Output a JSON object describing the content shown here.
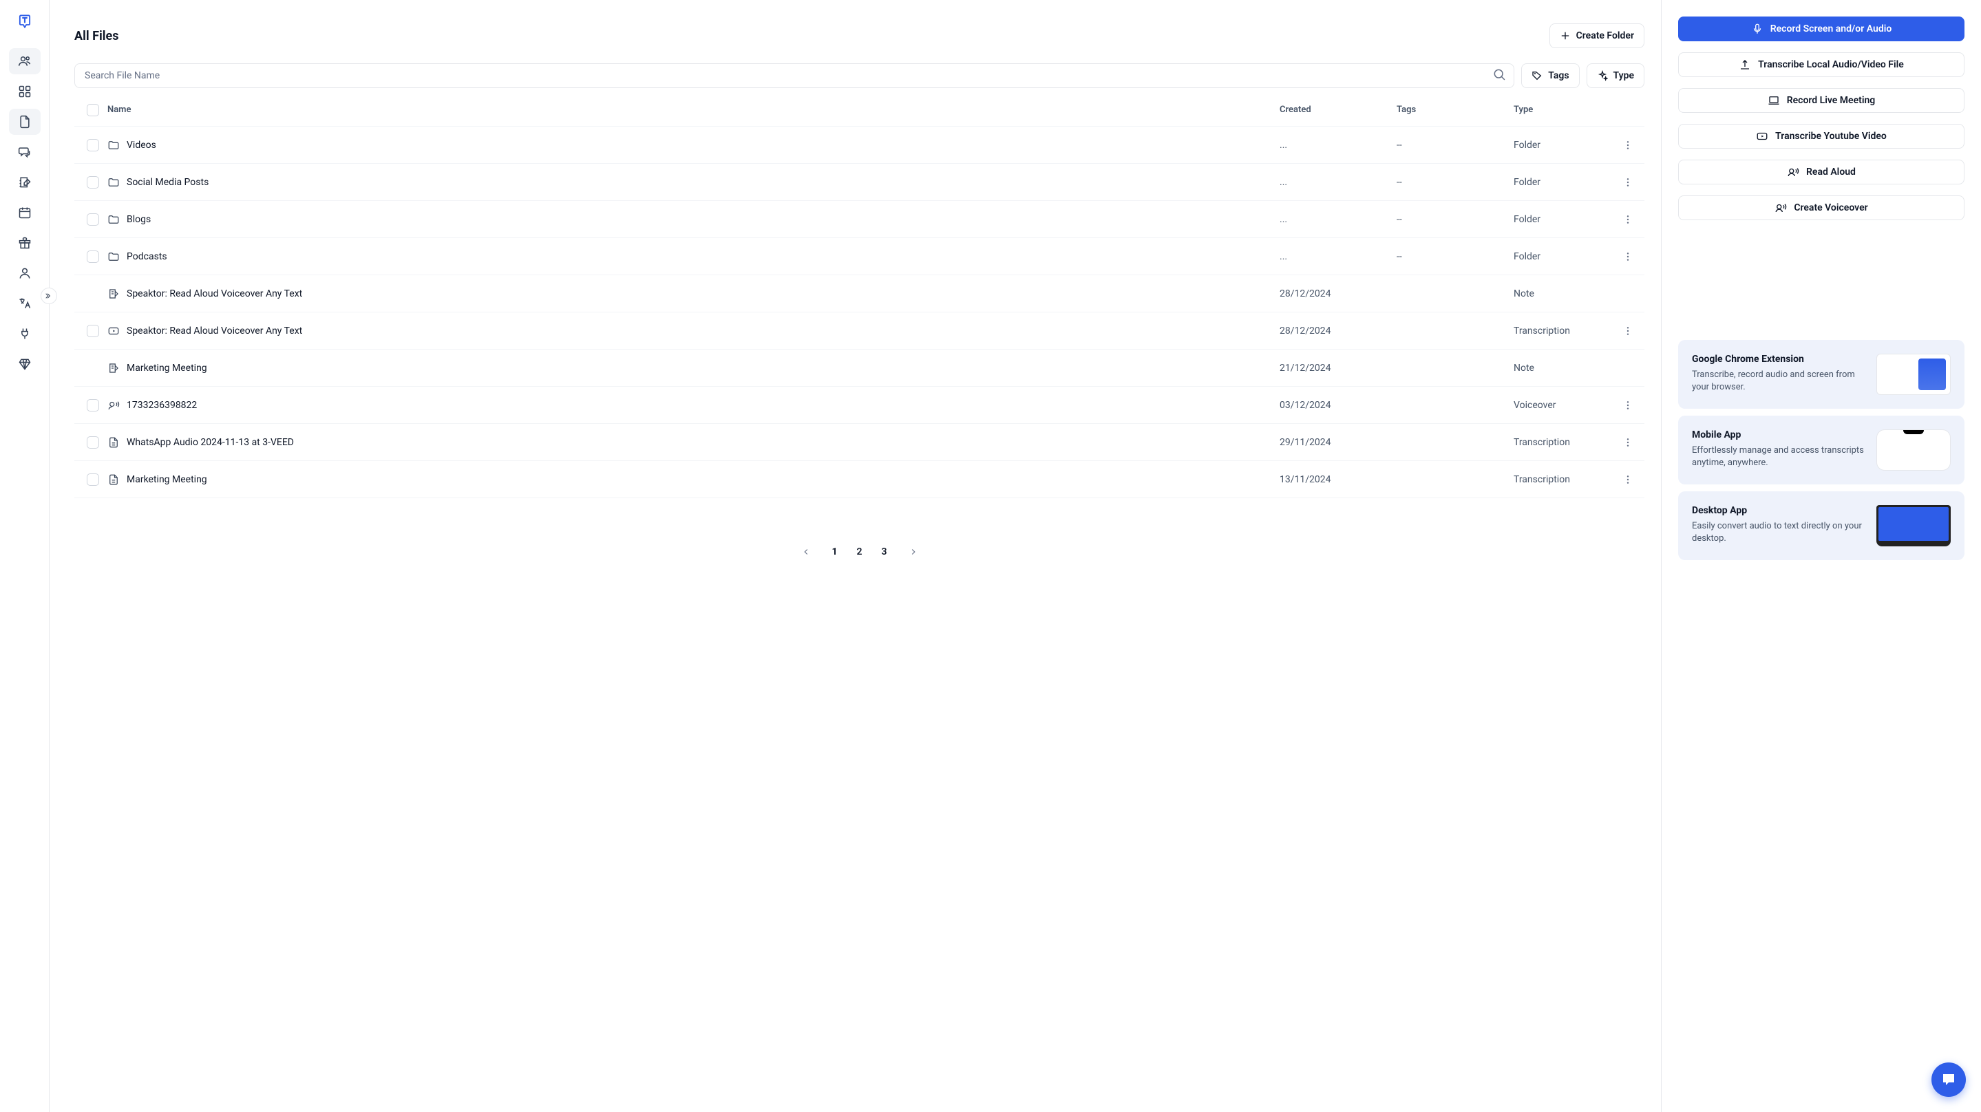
{
  "page_title": "All Files",
  "create_folder_label": "Create Folder",
  "search_placeholder": "Search File Name",
  "filters": {
    "tags": "Tags",
    "type": "Type"
  },
  "columns": {
    "name": "Name",
    "created": "Created",
    "tags": "Tags",
    "type": "Type"
  },
  "rows": [
    {
      "icon": "folder",
      "name": "Videos",
      "created": "...",
      "tags": "--",
      "type": "Folder",
      "checkbox": true,
      "more": true
    },
    {
      "icon": "folder",
      "name": "Social Media Posts",
      "created": "...",
      "tags": "--",
      "type": "Folder",
      "checkbox": true,
      "more": true
    },
    {
      "icon": "folder",
      "name": "Blogs",
      "created": "...",
      "tags": "--",
      "type": "Folder",
      "checkbox": true,
      "more": true
    },
    {
      "icon": "folder",
      "name": "Podcasts",
      "created": "...",
      "tags": "--",
      "type": "Folder",
      "checkbox": true,
      "more": true
    },
    {
      "icon": "note",
      "name": "Speaktor: Read Aloud Voiceover Any Text",
      "created": "28/12/2024",
      "tags": "",
      "type": "Note",
      "checkbox": false,
      "more": false
    },
    {
      "icon": "video",
      "name": "Speaktor: Read Aloud Voiceover Any Text",
      "created": "28/12/2024",
      "tags": "",
      "type": "Transcription",
      "checkbox": true,
      "more": true
    },
    {
      "icon": "note",
      "name": "Marketing Meeting",
      "created": "21/12/2024",
      "tags": "",
      "type": "Note",
      "checkbox": false,
      "more": false
    },
    {
      "icon": "voice",
      "name": "1733236398822",
      "created": "03/12/2024",
      "tags": "",
      "type": "Voiceover",
      "checkbox": true,
      "more": true
    },
    {
      "icon": "doc",
      "name": "WhatsApp Audio 2024-11-13 at 3-VEED",
      "created": "29/11/2024",
      "tags": "",
      "type": "Transcription",
      "checkbox": true,
      "more": true
    },
    {
      "icon": "doc",
      "name": "Marketing Meeting",
      "created": "13/11/2024",
      "tags": "",
      "type": "Transcription",
      "checkbox": true,
      "more": true
    }
  ],
  "pagination": {
    "pages": [
      "1",
      "2",
      "3"
    ],
    "active": "1"
  },
  "actions": {
    "record": "Record Screen and/or Audio",
    "transcribe_local": "Transcribe Local Audio/Video File",
    "record_meeting": "Record Live Meeting",
    "transcribe_youtube": "Transcribe Youtube Video",
    "read_aloud": "Read Aloud",
    "create_voiceover": "Create Voiceover"
  },
  "promos": [
    {
      "title": "Google Chrome Extension",
      "desc": "Transcribe, record audio and screen from your browser.",
      "img": "browser"
    },
    {
      "title": "Mobile App",
      "desc": "Effortlessly manage and access transcripts anytime, anywhere.",
      "img": "mobile"
    },
    {
      "title": "Desktop App",
      "desc": "Easily convert audio to text directly on your desktop.",
      "img": "desktop"
    }
  ]
}
